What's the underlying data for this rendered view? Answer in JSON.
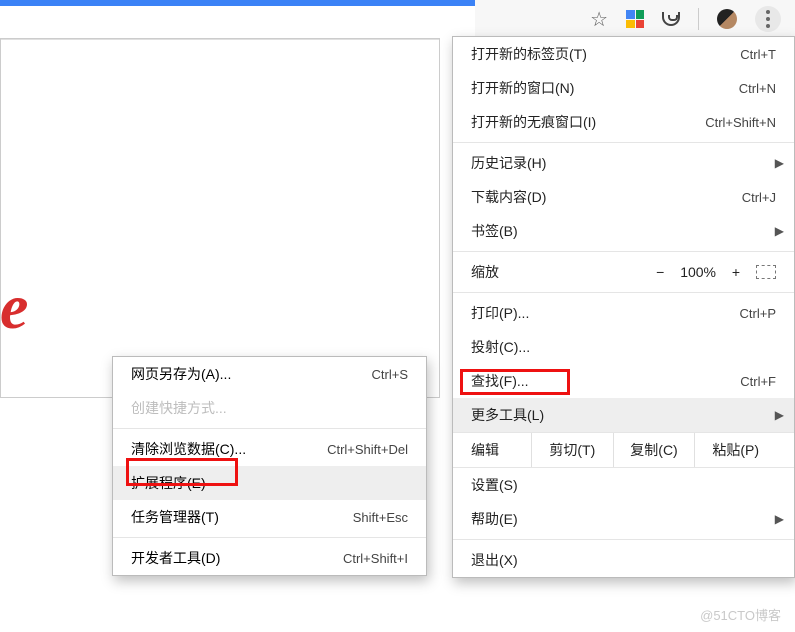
{
  "toolbar": {
    "star": "☆",
    "kebab": "more"
  },
  "menu": {
    "new_tab": {
      "label": "打开新的标签页(T)",
      "shortcut": "Ctrl+T"
    },
    "new_window": {
      "label": "打开新的窗口(N)",
      "shortcut": "Ctrl+N"
    },
    "incognito": {
      "label": "打开新的无痕窗口(I)",
      "shortcut": "Ctrl+Shift+N"
    },
    "history": {
      "label": "历史记录(H)"
    },
    "downloads": {
      "label": "下载内容(D)",
      "shortcut": "Ctrl+J"
    },
    "bookmarks": {
      "label": "书签(B)"
    },
    "zoom_label": "缩放",
    "zoom_minus": "−",
    "zoom_value": "100%",
    "zoom_plus": "+",
    "print": {
      "label": "打印(P)...",
      "shortcut": "Ctrl+P"
    },
    "cast": {
      "label": "投射(C)..."
    },
    "find": {
      "label": "查找(F)...",
      "shortcut": "Ctrl+F"
    },
    "more_tools": {
      "label": "更多工具(L)"
    },
    "edit_label": "编辑",
    "cut": "剪切(T)",
    "copy": "复制(C)",
    "paste": "粘贴(P)",
    "settings": {
      "label": "设置(S)"
    },
    "help": {
      "label": "帮助(E)"
    },
    "exit": {
      "label": "退出(X)"
    }
  },
  "submenu": {
    "save_as": {
      "label": "网页另存为(A)...",
      "shortcut": "Ctrl+S"
    },
    "create_shortcut": {
      "label": "创建快捷方式..."
    },
    "clear_data": {
      "label": "清除浏览数据(C)...",
      "shortcut": "Ctrl+Shift+Del"
    },
    "extensions": {
      "label": "扩展程序(E)"
    },
    "task_manager": {
      "label": "任务管理器(T)",
      "shortcut": "Shift+Esc"
    },
    "dev_tools": {
      "label": "开发者工具(D)",
      "shortcut": "Ctrl+Shift+I"
    }
  },
  "watermark": "@51CTO博客"
}
